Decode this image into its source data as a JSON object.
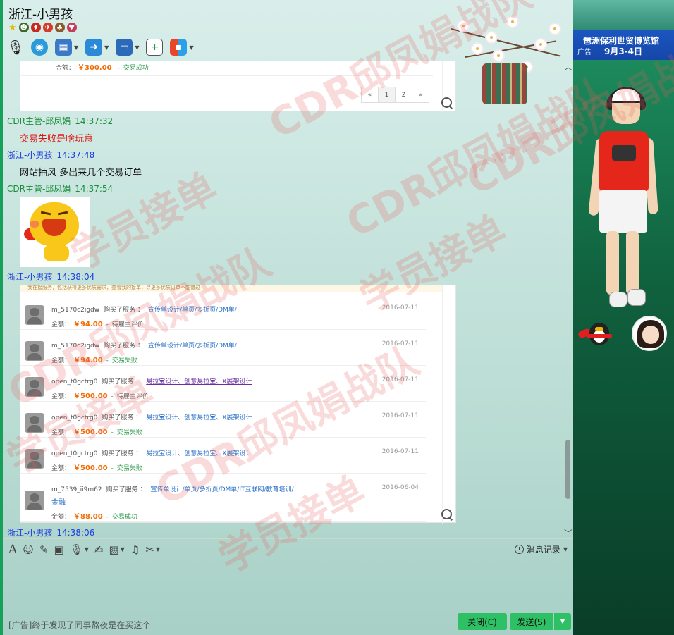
{
  "window": {
    "title": "浙江-小男孩",
    "minimize": "▁",
    "restore": "□",
    "close": "✕"
  },
  "messages": [
    {
      "sender": "CDR主管-邱凤娟",
      "time": "14:37:32",
      "text": "交易失败是啥玩意"
    },
    {
      "sender": "浙江-小男孩",
      "time": "14:37:48",
      "text": "网站抽风 多出来几个交易订单"
    },
    {
      "sender": "CDR主管-邱凤娟",
      "time": "14:37:54"
    },
    {
      "sender": "浙江-小男孩",
      "time": "14:38:04"
    },
    {
      "sender": "浙江-小男孩",
      "time": "14:38:06"
    }
  ],
  "top_card": {
    "amount_label": "金额：",
    "amount": "￥300.00",
    "status": "交易成功",
    "pager": [
      "«",
      "1",
      "2",
      "»"
    ]
  },
  "orders_card": {
    "notice": "我在接服务，包括获得更多优质需求，查看我的接单，寻更多优质订单不能错过",
    "purchased": "购买了服务 ：",
    "amount_label": "金额：",
    "rows": [
      {
        "user": "m_5170c2igdw",
        "service": "宣传单设计/单页/多折页/DM单/",
        "date": "2016-07-11",
        "amount": "￥94.00",
        "status": "待雇主评价"
      },
      {
        "user": "m_5170c2igdw",
        "service": "宣传单设计/单页/多折页/DM单/",
        "date": "2016-07-11",
        "amount": "￥94.00",
        "status": "交易失败"
      },
      {
        "user": "open_t0gctrg0",
        "service": "易拉宝设计、创意易拉宝、X展架设计",
        "date": "2016-07-11",
        "amount": "￥500.00",
        "status": "待雇主评价"
      },
      {
        "user": "open_t0gctrg0",
        "service": "易拉宝设计、创意易拉宝、X展架设计",
        "date": "2016-07-11",
        "amount": "￥500.00",
        "status": "交易失败"
      },
      {
        "user": "open_t0gctrg0",
        "service": "易拉宝设计、创意易拉宝、X展架设计",
        "date": "2016-07-11",
        "amount": "￥500.00",
        "status": "交易失败"
      },
      {
        "user": "m_7539_ii9m62",
        "service": "宣传单设计/单页/多折页/DM单/IT互联网/教育培训/",
        "service2": "金融",
        "date": "2016-06-04",
        "amount": "￥88.00",
        "status": "交易成功"
      }
    ]
  },
  "input_toolbar": {
    "history": "消息记录"
  },
  "footer": {
    "ad_text": "[广告]终于发现了同事熬夜是在买这个",
    "close_button": "关闭(C)",
    "send_button": "发送(S)"
  },
  "ad_banner": {
    "line1": "琶洲保利世贸博览馆",
    "tag": "广告",
    "date": "9月3-4日"
  },
  "watermark": {
    "team": "CDR邱凤娟战队",
    "order": "学员接单"
  },
  "colors": {
    "accent_green": "#2ec064",
    "sender_other": "#1a8d3a",
    "sender_self": "#1a3ce0",
    "price": "#f26a00"
  }
}
